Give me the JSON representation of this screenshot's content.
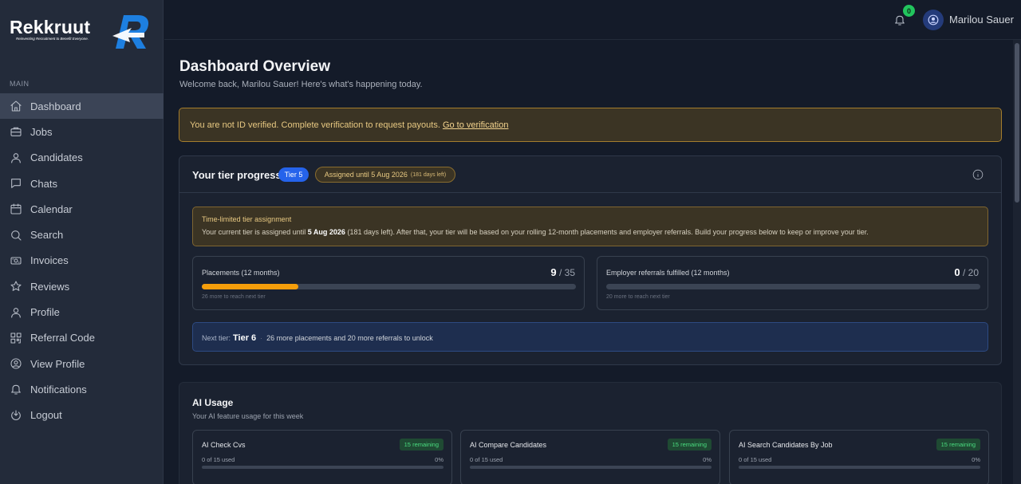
{
  "brand": {
    "name": "Rekkruut",
    "tagline": "Reinventing Recruitment to Benefit Everyone."
  },
  "sidebar": {
    "section": "MAIN",
    "items": [
      {
        "label": "Dashboard",
        "icon": "home-icon",
        "active": true
      },
      {
        "label": "Jobs",
        "icon": "briefcase-icon"
      },
      {
        "label": "Candidates",
        "icon": "user-icon"
      },
      {
        "label": "Chats",
        "icon": "chat-icon"
      },
      {
        "label": "Calendar",
        "icon": "calendar-icon"
      },
      {
        "label": "Search",
        "icon": "search-icon"
      },
      {
        "label": "Invoices",
        "icon": "invoice-icon"
      },
      {
        "label": "Reviews",
        "icon": "star-icon"
      },
      {
        "label": "Profile",
        "icon": "user-icon"
      },
      {
        "label": "Referral Code",
        "icon": "qr-code-icon"
      },
      {
        "label": "View Profile",
        "icon": "user-circle-icon"
      },
      {
        "label": "Notifications",
        "icon": "bell-icon"
      },
      {
        "label": "Logout",
        "icon": "logout-icon"
      }
    ]
  },
  "topbar": {
    "notification_count": "0",
    "username": "Marilou Sauer"
  },
  "page": {
    "title": "Dashboard Overview",
    "subtitle": "Welcome back, Marilou Sauer! Here's what's happening today."
  },
  "verification": {
    "text": "You are not ID verified. Complete verification to request payouts. ",
    "link": "Go to verification"
  },
  "tier": {
    "title": "Your tier progress",
    "tier_label": "Tier 5",
    "assigned_label": "Assigned until 5 Aug 2026",
    "assigned_days": "(181 days left)",
    "notice_title": "Time-limited tier assignment",
    "notice_pre": "Your current tier is assigned until ",
    "notice_date": "5 Aug 2026",
    "notice_post": " (181 days left). After that, your tier will be based on your rolling 12-month placements and employer referrals. Build your progress below to keep or improve your tier.",
    "placements": {
      "label": "Placements (12 months)",
      "value": "9",
      "total": "/ 35",
      "progress": 0.257,
      "note": "26 more to reach next tier"
    },
    "referrals": {
      "label": "Employer referrals fulfilled (12 months)",
      "value": "0",
      "total": "/ 20",
      "progress": 0,
      "note": "20 more to reach next tier"
    },
    "next": {
      "label": "Next tier:",
      "tier": "Tier 6",
      "separator": "·",
      "desc": "26 more placements and 20 more referrals to unlock"
    }
  },
  "ai_usage": {
    "title": "AI Usage",
    "subtitle": "Your AI feature usage for this week",
    "items": [
      {
        "name": "AI Check Cvs",
        "badge": "15 remaining",
        "used": "0 of 15 used",
        "pct": "0%"
      },
      {
        "name": "AI Compare Candidates",
        "badge": "15 remaining",
        "used": "0 of 15 used",
        "pct": "0%"
      },
      {
        "name": "AI Search Candidates By Job",
        "badge": "15 remaining",
        "used": "0 of 15 used",
        "pct": "0%"
      }
    ]
  },
  "colors": {
    "accent": "#2563eb",
    "progress": "#f59e0b",
    "success": "#22c55e",
    "warning_border": "#a47d2d"
  }
}
